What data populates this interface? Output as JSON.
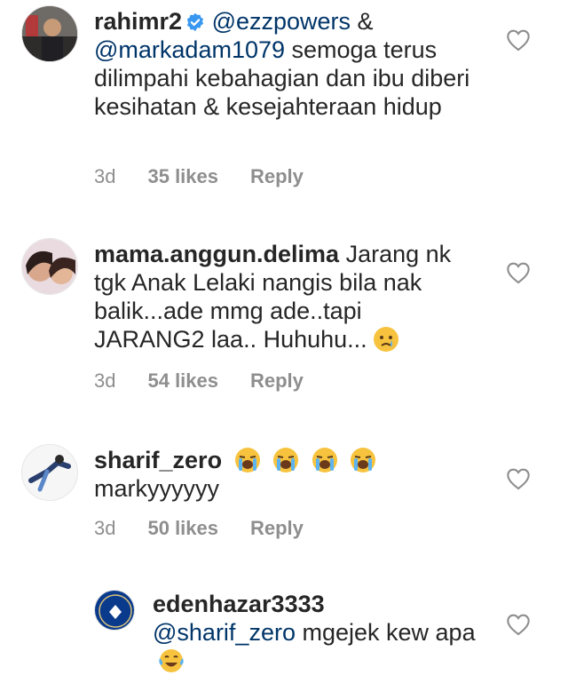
{
  "comments": [
    {
      "username": "rahimr2",
      "verified": true,
      "mention1": "@ezzpowers",
      "amp": " & ",
      "mention2": "@markadam1079",
      "text": " semoga terus dilimpahi kebahagian dan ibu diberi kesihatan & kesejahteraan hidup",
      "age": "3d",
      "likes": "35 likes",
      "reply": "Reply"
    },
    {
      "username": "mama.anggun.delima",
      "text": " Jarang nk tgk Anak Lelaki nangis bila nak balik...ade mmg ade..tapi JARANG2 laa.. Huhuhu...",
      "emoji": "crying-face",
      "age": "3d",
      "likes": "54 likes",
      "reply": "Reply"
    },
    {
      "username": "sharif_zero",
      "emoji": "loudly-crying-face x4",
      "text": "markyyyyyy",
      "age": "3d",
      "likes": "50 likes",
      "reply": "Reply"
    },
    {
      "username": "edenhazar3333",
      "mention1": "@sharif_zero",
      "text": " mgejek kew apa",
      "emoji": "tears-of-joy-face"
    }
  ],
  "colors": {
    "text": "#262626",
    "meta": "#8e8e8e",
    "mention": "#003569",
    "verified": "#3897f0"
  }
}
